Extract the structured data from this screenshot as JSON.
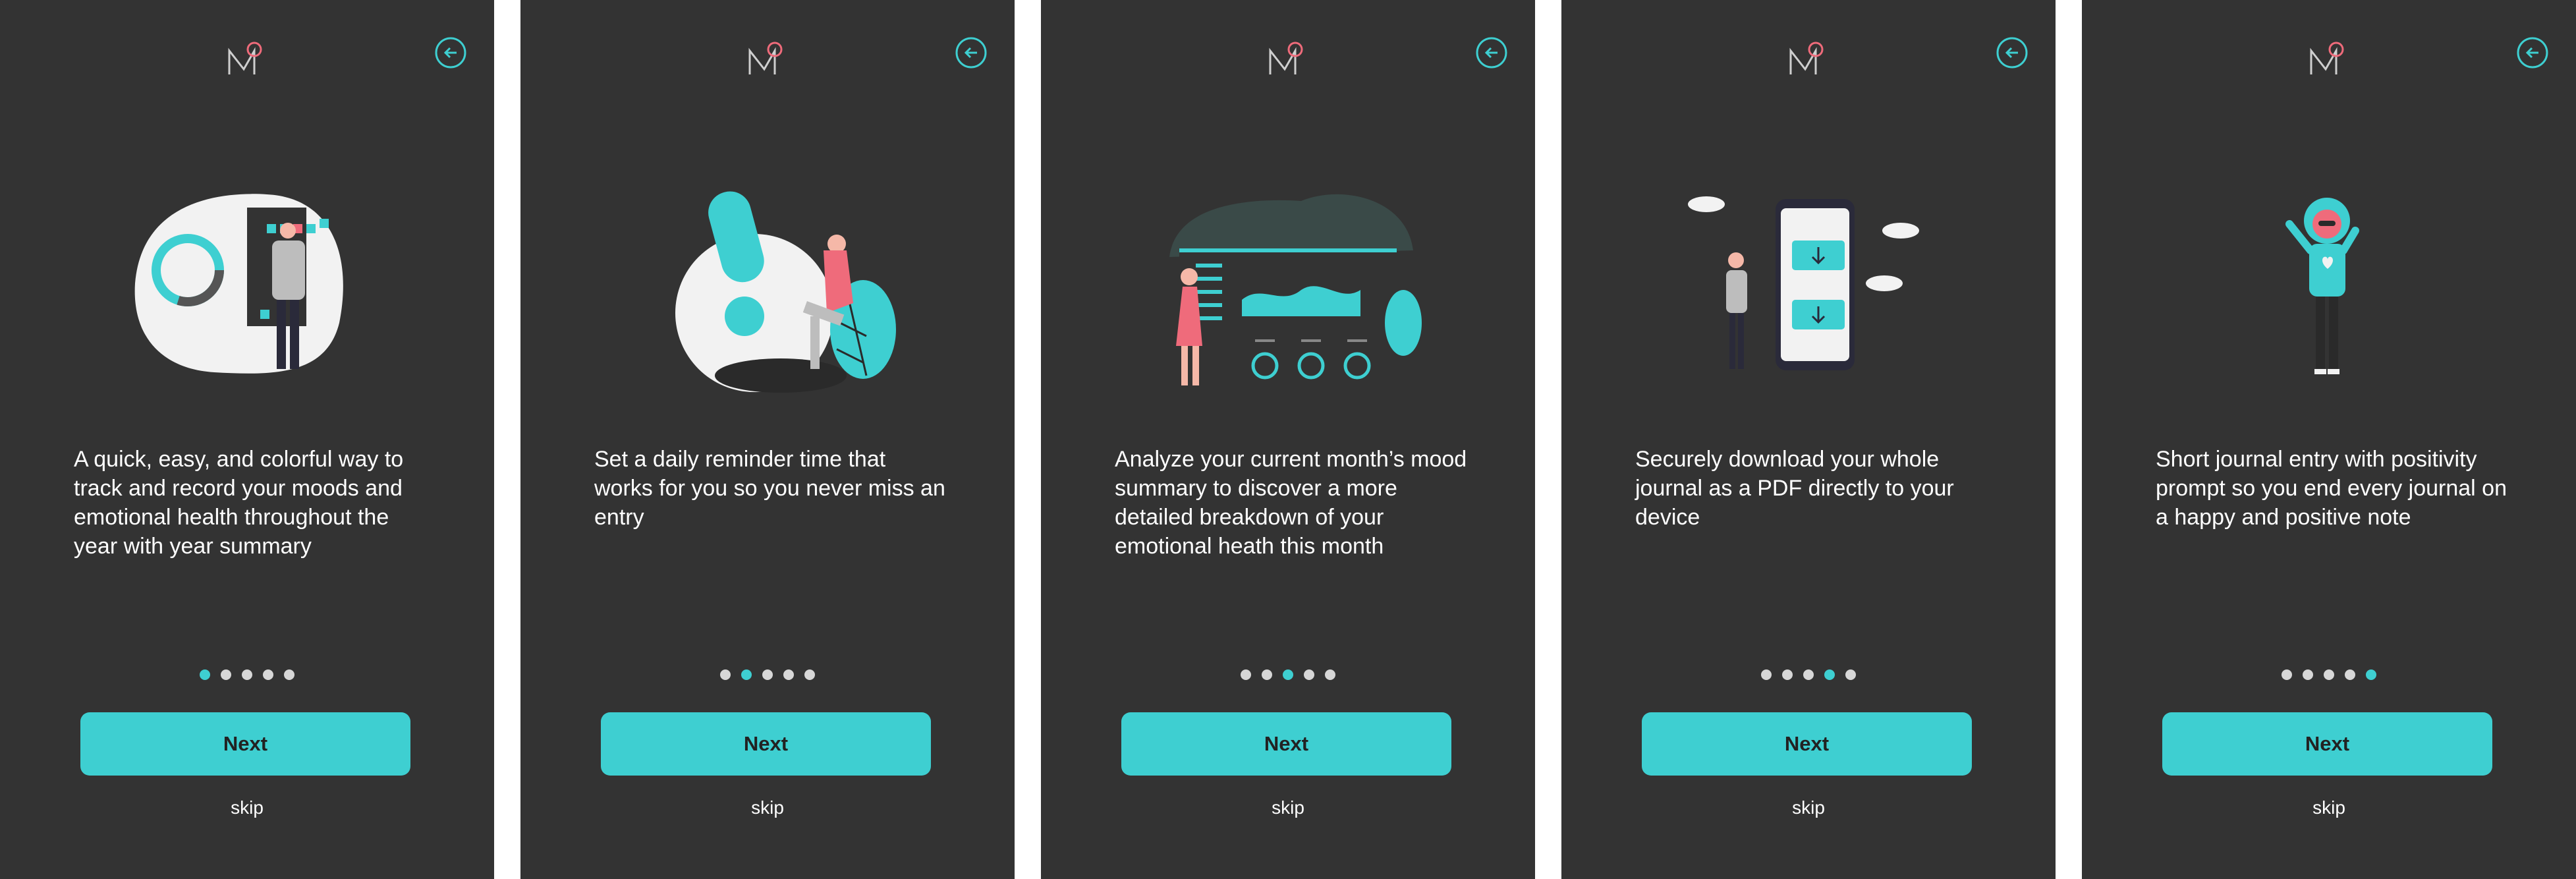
{
  "colors": {
    "background": "#333333",
    "accent": "#3ecfd1",
    "pink": "#ef6b7b",
    "dot_inactive": "#d7d7d7",
    "text": "#ffffff"
  },
  "screens": [
    {
      "description": "A quick, easy, and colorful way to track and record your moods and emotional health throughout the year with year summary",
      "active_dot": 0,
      "next_label": "Next",
      "skip_label": "skip",
      "illustration": "mood-tracking-illustration"
    },
    {
      "description": "Set a daily reminder time that works for you so you never miss an entry",
      "active_dot": 1,
      "next_label": "Next",
      "skip_label": "skip",
      "illustration": "reminder-illustration"
    },
    {
      "description": "Analyze your current month’s mood summary to discover a more detailed breakdown of your emotional heath this month",
      "active_dot": 2,
      "next_label": "Next",
      "skip_label": "skip",
      "illustration": "analytics-illustration"
    },
    {
      "description": "Securely download your whole journal as a PDF directly to your device",
      "active_dot": 3,
      "next_label": "Next",
      "skip_label": "skip",
      "illustration": "download-illustration"
    },
    {
      "description": "Short journal entry with positivity prompt so you end every journal on a happy and positive note",
      "active_dot": 4,
      "next_label": "Next",
      "skip_label": "skip",
      "illustration": "journal-illustration"
    }
  ],
  "icons": {
    "logo": "mood-logo-icon",
    "back": "back-arrow-icon"
  }
}
